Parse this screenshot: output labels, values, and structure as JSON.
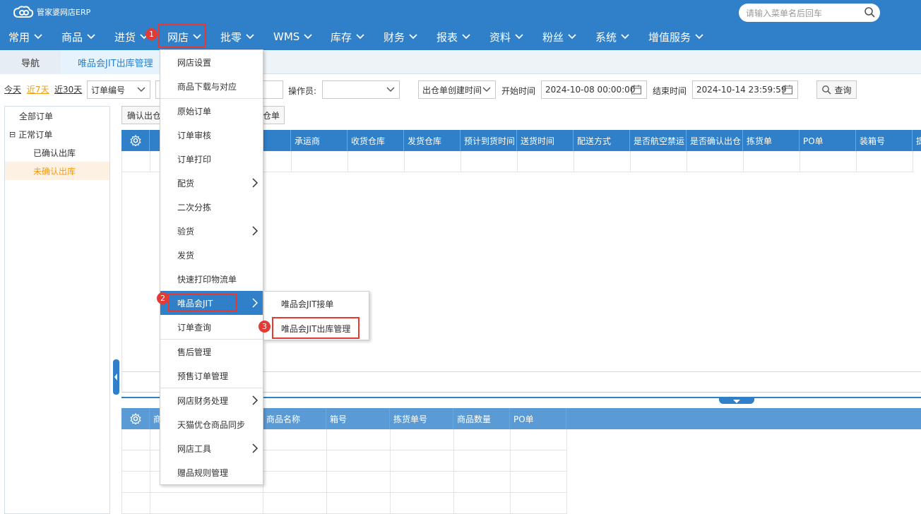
{
  "app": {
    "title": "管家婆网店ERP",
    "search_placeholder": "请输入菜单名后回车"
  },
  "nav": [
    "常用",
    "商品",
    "进货",
    "网店",
    "批零",
    "WMS",
    "库存",
    "财务",
    "报表",
    "资料",
    "粉丝",
    "系统",
    "增值服务"
  ],
  "tabs": {
    "nav": "导航",
    "current": "唯品会JIT出库管理"
  },
  "filters": {
    "today": "今天",
    "last7": "近7天",
    "last30": "近30天",
    "order_field": "订单编号",
    "operator_label": "操作员:",
    "operator_value": "",
    "time_field": "出仓单创建时间",
    "start_label": "开始时间",
    "start_value": "2024-10-08 00:00:00",
    "end_label": "结束时间",
    "end_value": "2024-10-14 23:59:59",
    "query": "查询"
  },
  "tree": {
    "all": "全部订单",
    "normal": "正常订单",
    "confirmed": "已确认出库",
    "unconfirmed": "未确认出库",
    "expand_symbol": "⊟"
  },
  "toolbar": {
    "confirm": "确认出仓",
    "other": "仓单"
  },
  "top_grid": {
    "columns": [
      "承运商",
      "收货仓库",
      "发货仓库",
      "预计到货时间",
      "送货时间",
      "配送方式",
      "是否航空禁运",
      "是否确认出仓",
      "拣货单",
      "PO单",
      "装箱号",
      "提"
    ]
  },
  "bottom_grid": {
    "columns": [
      "商",
      "商品名称",
      "箱号",
      "拣货单号",
      "商品数量",
      "PO单"
    ]
  },
  "menu": {
    "items": [
      "网店设置",
      "商品下载与对应",
      "原始订单",
      "订单审核",
      "订单打印",
      "配货",
      "二次分拣",
      "验货",
      "发货",
      "快速打印物流单",
      "唯品会JIT",
      "订单查询",
      "售后管理",
      "预售订单管理",
      "网店财务处理",
      "天猫优仓商品同步",
      "网店工具",
      "赠品规则管理"
    ]
  },
  "submenu": {
    "items": [
      "唯品会JIT接单",
      "唯品会JIT出库管理"
    ]
  },
  "badges": [
    "1",
    "2",
    "3"
  ],
  "colors": {
    "primary": "#2f80c9",
    "highlight": "#e53935",
    "active_tree": "#f39c12"
  }
}
